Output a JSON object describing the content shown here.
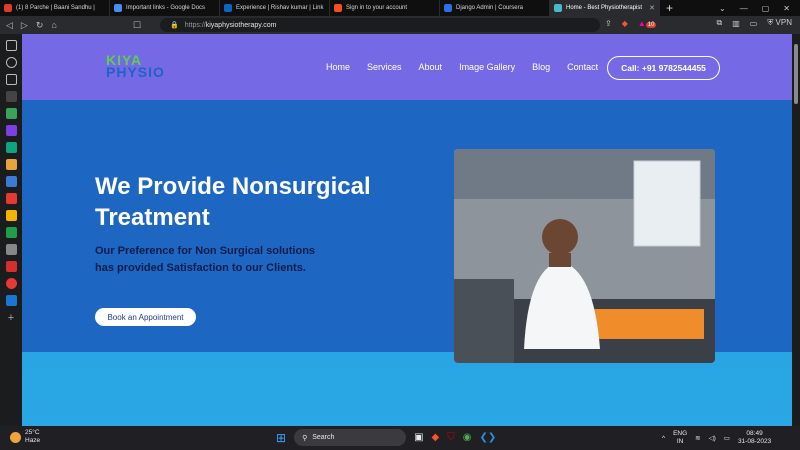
{
  "browser": {
    "tabs": [
      {
        "label": "(1) 8 Parche | Baani Sandhu |",
        "color": "#e03b2d"
      },
      {
        "label": "Important links - Google Docs",
        "color": "#4a8cf0"
      },
      {
        "label": "Experience | Rishav kumar | Link",
        "color": "#0a66c2"
      },
      {
        "label": "Sign in to your account",
        "color": "#f25022"
      },
      {
        "label": "Django Admin | Coursera",
        "color": "#2f6fe0"
      },
      {
        "label": "Home - Best Physiotherapist",
        "color": "#4db6c8"
      }
    ],
    "new_tab": "+",
    "url_protocol": "https://",
    "url_domain": "kiyaphysiotherapy.com",
    "vpn_label": "VPN",
    "badge_count": "10"
  },
  "site": {
    "logo_top": "KIYA",
    "logo_bottom": "PHYSIO",
    "nav": [
      "Home",
      "Services",
      "About",
      "Image Gallery",
      "Blog",
      "Contact"
    ],
    "call_button": "Call: +91 9782544455",
    "hero_title": "We Provide Nonsurgical Treatment",
    "hero_subtitle": "Our Preference for Non Surgical solutions has provided Satisfaction to our Clients.",
    "book_button": "Book an Appointment"
  },
  "taskbar": {
    "temperature": "25°C",
    "weather": "Haze",
    "search_placeholder": "Search",
    "language": "ENG",
    "region": "IN",
    "time": "08:49",
    "date": "31-08-2023"
  }
}
